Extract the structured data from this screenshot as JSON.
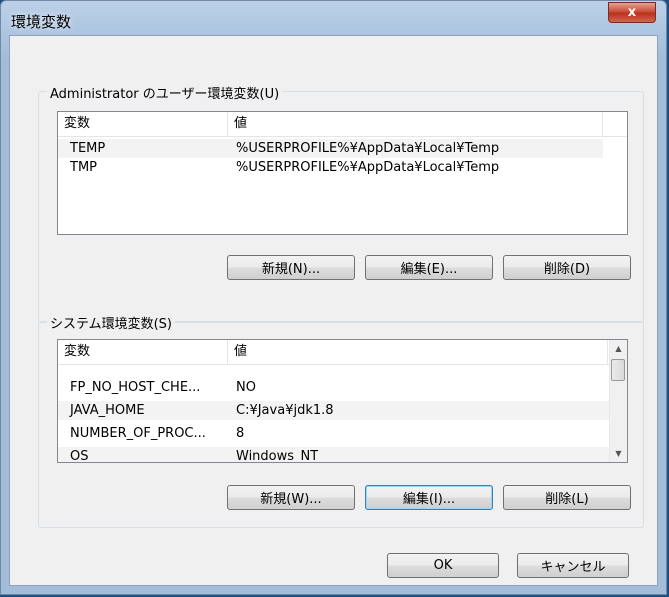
{
  "window": {
    "title": "環境変数",
    "close_glyph": "x"
  },
  "user_group": {
    "legend": "Administrator のユーザー環境変数(U)",
    "columns": [
      "変数",
      "値"
    ],
    "rows": [
      {
        "name": "TEMP",
        "value": "%USERPROFILE%¥AppData¥Local¥Temp"
      },
      {
        "name": "TMP",
        "value": "%USERPROFILE%¥AppData¥Local¥Temp"
      }
    ],
    "buttons": {
      "new": "新規(N)...",
      "edit": "編集(E)...",
      "delete": "削除(D)"
    }
  },
  "system_group": {
    "legend": "システム環境変数(S)",
    "columns": [
      "変数",
      "値"
    ],
    "rows": [
      {
        "name": "FP_NO_HOST_CHE...",
        "value": "NO"
      },
      {
        "name": "JAVA_HOME",
        "value": "C:¥Java¥jdk1.8"
      },
      {
        "name": "NUMBER_OF_PROC...",
        "value": "8"
      },
      {
        "name": "OS",
        "value": "Windows_NT"
      }
    ],
    "buttons": {
      "new": "新規(W)...",
      "edit": "編集(I)...",
      "delete": "削除(L)"
    }
  },
  "footer": {
    "ok": "OK",
    "cancel": "キャンセル"
  }
}
